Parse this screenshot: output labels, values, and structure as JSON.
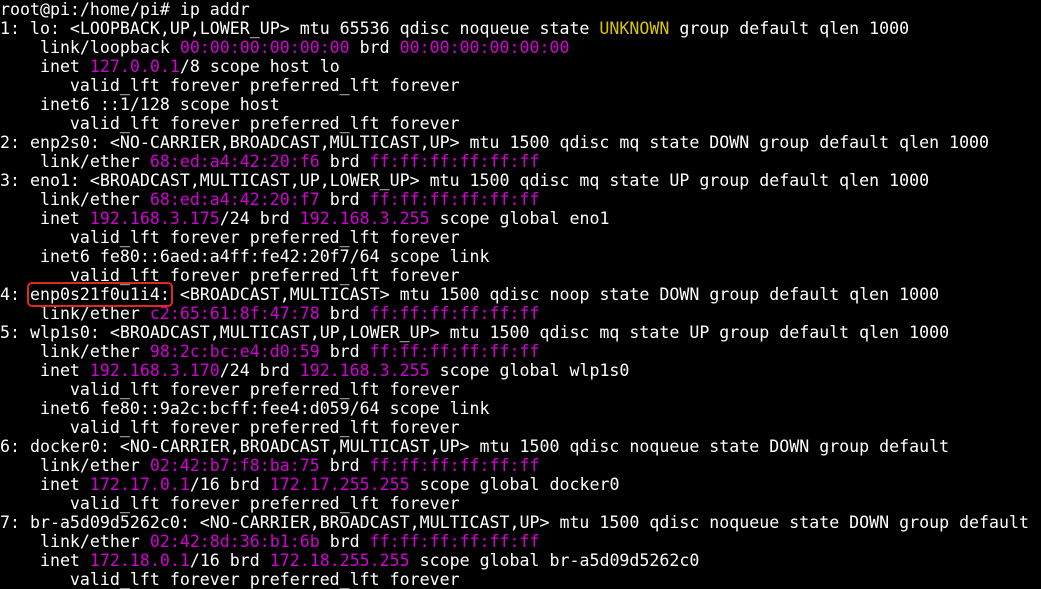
{
  "terminal": {
    "colors": {
      "background": "#000000",
      "text": "#ffffff",
      "address": "#d200d2",
      "state_unknown": "#d8c400",
      "highlight_box": "#e12a1f"
    },
    "lines": [
      [
        {
          "t": "root@pi:/home/pi# ip addr",
          "c": "plain"
        }
      ],
      [
        {
          "t": "1: lo: <LOOPBACK,UP,LOWER_UP> mtu 65536 qdisc noqueue state ",
          "c": "plain"
        },
        {
          "t": "UNKNOWN",
          "c": "warn"
        },
        {
          "t": " group default qlen 1000",
          "c": "plain"
        }
      ],
      [
        {
          "t": "    link/loopback ",
          "c": "plain"
        },
        {
          "t": "00:00:00:00:00:00",
          "c": "mac"
        },
        {
          "t": " brd ",
          "c": "plain"
        },
        {
          "t": "00:00:00:00:00:00",
          "c": "mac"
        }
      ],
      [
        {
          "t": "    inet ",
          "c": "plain"
        },
        {
          "t": "127.0.0.1",
          "c": "ip"
        },
        {
          "t": "/8 scope host lo",
          "c": "plain"
        }
      ],
      [
        {
          "t": "       valid_lft forever preferred_lft forever",
          "c": "plain"
        }
      ],
      [
        {
          "t": "    inet6 ::1/128 scope host",
          "c": "plain"
        }
      ],
      [
        {
          "t": "       valid_lft forever preferred_lft forever",
          "c": "plain"
        }
      ],
      [
        {
          "t": "2: enp2s0: <NO-CARRIER,BROADCAST,MULTICAST,UP> mtu 1500 qdisc mq state DOWN group default qlen 1000",
          "c": "plain"
        }
      ],
      [
        {
          "t": "    link/ether ",
          "c": "plain"
        },
        {
          "t": "68:ed:a4:42:20:f6",
          "c": "mac"
        },
        {
          "t": " brd ",
          "c": "plain"
        },
        {
          "t": "ff:ff:ff:ff:ff:ff",
          "c": "mac"
        }
      ],
      [
        {
          "t": "3: eno1: <BROADCAST,MULTICAST,UP,LOWER_UP> mtu 1500 qdisc mq state UP group default qlen 1000",
          "c": "plain"
        }
      ],
      [
        {
          "t": "    link/ether ",
          "c": "plain"
        },
        {
          "t": "68:ed:a4:42:20:f7",
          "c": "mac"
        },
        {
          "t": " brd ",
          "c": "plain"
        },
        {
          "t": "ff:ff:ff:ff:ff:ff",
          "c": "mac"
        }
      ],
      [
        {
          "t": "    inet ",
          "c": "plain"
        },
        {
          "t": "192.168.3.175",
          "c": "ip"
        },
        {
          "t": "/24 brd ",
          "c": "plain"
        },
        {
          "t": "192.168.3.255",
          "c": "ip"
        },
        {
          "t": " scope global eno1",
          "c": "plain"
        }
      ],
      [
        {
          "t": "       valid_lft forever preferred_lft forever",
          "c": "plain"
        }
      ],
      [
        {
          "t": "    inet6 fe80::6aed:a4ff:fe42:20f7/64 scope link",
          "c": "plain"
        }
      ],
      [
        {
          "t": "       valid_lft forever preferred_lft forever",
          "c": "plain"
        }
      ],
      [
        {
          "t": "4: ",
          "c": "plain"
        },
        {
          "t": "enp0s21f0u1i4:",
          "c": "plain",
          "hl": true
        },
        {
          "t": " <BROADCAST,MULTICAST> mtu 1500 qdisc noop state DOWN group default qlen 1000",
          "c": "plain"
        }
      ],
      [
        {
          "t": "    link/ether ",
          "c": "plain"
        },
        {
          "t": "c2:65:61:8f:47:78",
          "c": "mac"
        },
        {
          "t": " brd ",
          "c": "plain"
        },
        {
          "t": "ff:ff:ff:ff:ff:ff",
          "c": "mac"
        }
      ],
      [
        {
          "t": "5: wlp1s0: <BROADCAST,MULTICAST,UP,LOWER_UP> mtu 1500 qdisc mq state UP group default qlen 1000",
          "c": "plain"
        }
      ],
      [
        {
          "t": "    link/ether ",
          "c": "plain"
        },
        {
          "t": "98:2c:bc:e4:d0:59",
          "c": "mac"
        },
        {
          "t": " brd ",
          "c": "plain"
        },
        {
          "t": "ff:ff:ff:ff:ff:ff",
          "c": "mac"
        }
      ],
      [
        {
          "t": "    inet ",
          "c": "plain"
        },
        {
          "t": "192.168.3.170",
          "c": "ip"
        },
        {
          "t": "/24 brd ",
          "c": "plain"
        },
        {
          "t": "192.168.3.255",
          "c": "ip"
        },
        {
          "t": " scope global wlp1s0",
          "c": "plain"
        }
      ],
      [
        {
          "t": "       valid_lft forever preferred_lft forever",
          "c": "plain"
        }
      ],
      [
        {
          "t": "    inet6 fe80::9a2c:bcff:fee4:d059/64 scope link",
          "c": "plain"
        }
      ],
      [
        {
          "t": "       valid_lft forever preferred_lft forever",
          "c": "plain"
        }
      ],
      [
        {
          "t": "6: docker0: <NO-CARRIER,BROADCAST,MULTICAST,UP> mtu 1500 qdisc noqueue state DOWN group default",
          "c": "plain"
        }
      ],
      [
        {
          "t": "    link/ether ",
          "c": "plain"
        },
        {
          "t": "02:42:b7:f8:ba:75",
          "c": "mac"
        },
        {
          "t": " brd ",
          "c": "plain"
        },
        {
          "t": "ff:ff:ff:ff:ff:ff",
          "c": "mac"
        }
      ],
      [
        {
          "t": "    inet ",
          "c": "plain"
        },
        {
          "t": "172.17.0.1",
          "c": "ip"
        },
        {
          "t": "/16 brd ",
          "c": "plain"
        },
        {
          "t": "172.17.255.255",
          "c": "ip"
        },
        {
          "t": " scope global docker0",
          "c": "plain"
        }
      ],
      [
        {
          "t": "       valid_lft forever preferred_lft forever",
          "c": "plain"
        }
      ],
      [
        {
          "t": "7: br-a5d09d5262c0: <NO-CARRIER,BROADCAST,MULTICAST,UP> mtu 1500 qdisc noqueue state DOWN group default",
          "c": "plain"
        }
      ],
      [
        {
          "t": "    link/ether ",
          "c": "plain"
        },
        {
          "t": "02:42:8d:36:b1:6b",
          "c": "mac"
        },
        {
          "t": " brd ",
          "c": "plain"
        },
        {
          "t": "ff:ff:ff:ff:ff:ff",
          "c": "mac"
        }
      ],
      [
        {
          "t": "    inet ",
          "c": "plain"
        },
        {
          "t": "172.18.0.1",
          "c": "ip"
        },
        {
          "t": "/16 brd ",
          "c": "plain"
        },
        {
          "t": "172.18.255.255",
          "c": "ip"
        },
        {
          "t": " scope global br-a5d09d5262c0",
          "c": "plain"
        }
      ],
      [
        {
          "t": "       valid_lft forever preferred_lft forever",
          "c": "plain"
        }
      ]
    ]
  }
}
